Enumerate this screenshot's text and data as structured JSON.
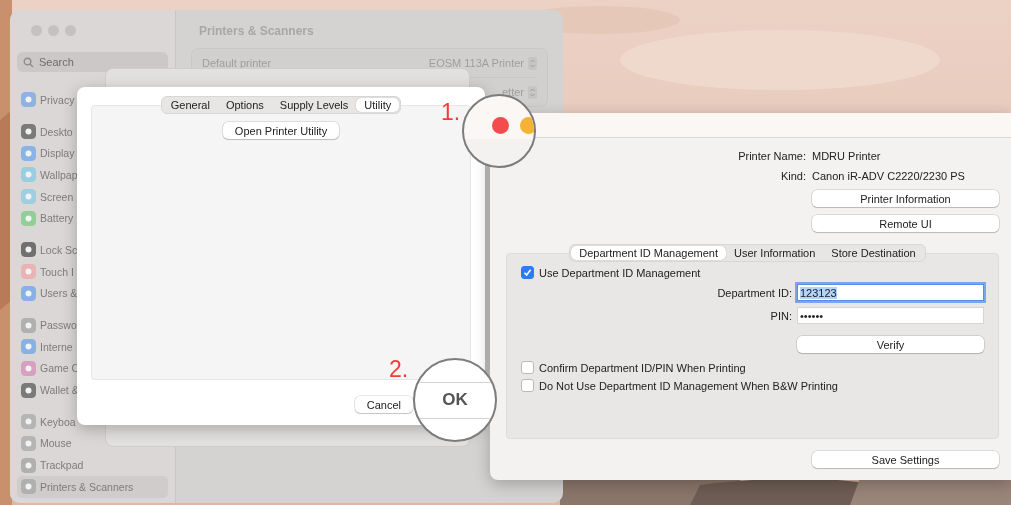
{
  "settings_window": {
    "title": "Printers & Scanners",
    "search": {
      "placeholder": "Search"
    },
    "sidebar": {
      "groups": [
        {
          "items": [
            {
              "label": "Privacy",
              "color": "#8fb2e0",
              "selected": false
            }
          ]
        },
        {
          "items": [
            {
              "label": "Deskto",
              "color": "#7a7a7a",
              "selected": false
            },
            {
              "label": "Display",
              "color": "#8ab4e6",
              "selected": false
            },
            {
              "label": "Wallpap",
              "color": "#98cde2",
              "selected": false
            },
            {
              "label": "Screen",
              "color": "#a0cde0",
              "selected": false
            },
            {
              "label": "Battery",
              "color": "#92cf98",
              "selected": false
            }
          ]
        },
        {
          "items": [
            {
              "label": "Lock Sc",
              "color": "#707070",
              "selected": false
            },
            {
              "label": "Touch I",
              "color": "#e8b4b4",
              "selected": false
            },
            {
              "label": "Users &",
              "color": "#88b0e6",
              "selected": false
            }
          ]
        },
        {
          "items": [
            {
              "label": "Passwo",
              "color": "#b0b0b0",
              "selected": false
            },
            {
              "label": "Interne",
              "color": "#88b0e6",
              "selected": false
            },
            {
              "label": "Game C",
              "color": "#d8a0c0",
              "selected": false
            },
            {
              "label": "Wallet &",
              "color": "#7a7a7a",
              "selected": false
            }
          ]
        },
        {
          "items": [
            {
              "label": "Keyboa",
              "color": "#b5b5b5",
              "selected": false
            },
            {
              "label": "Mouse",
              "color": "#b5b5b5",
              "selected": false
            },
            {
              "label": "Trackpad",
              "color": "#b0b0b0",
              "selected": false
            },
            {
              "label": "Printers & Scanners",
              "color": "#b0b0b0",
              "selected": true
            }
          ]
        }
      ]
    },
    "rows": [
      {
        "label": "Default printer",
        "value": "EOSM 113A Printer"
      },
      {
        "value": "etter"
      }
    ]
  },
  "dialog": {
    "tabs": [
      {
        "label": "General",
        "selected": false
      },
      {
        "label": "Options",
        "selected": false
      },
      {
        "label": "Supply Levels",
        "selected": false
      },
      {
        "label": "Utility",
        "selected": true
      }
    ],
    "open_utility_button": "Open Printer Utility",
    "cancel_button": "Cancel"
  },
  "annotations": [
    {
      "label": "1."
    },
    {
      "label": "2."
    }
  ],
  "ok_magnifier": {
    "text": "OK"
  },
  "printer_window": {
    "printer_name_label": "Printer Name:",
    "printer_name": "MDRU Printer",
    "kind_label": "Kind:",
    "kind": "Canon iR-ADV C2220/2230 PS",
    "buttons": [
      "Printer Information",
      "Remote UI"
    ],
    "tabs": [
      {
        "label": "Department ID Management",
        "selected": true
      },
      {
        "label": "User Information",
        "selected": false
      },
      {
        "label": "Store Destination",
        "selected": false
      }
    ],
    "use_department": {
      "label": "Use Department ID Management",
      "checked": true
    },
    "department_id": {
      "label": "Department ID:",
      "value": "123123",
      "focused": true
    },
    "pin": {
      "label": "PIN:",
      "value": "••••••"
    },
    "verify_button": "Verify",
    "options": [
      {
        "label": "Confirm Department ID/PIN When Printing",
        "checked": false
      },
      {
        "label": "Do Not Use Department ID Management When B&W Printing",
        "checked": false
      }
    ],
    "save_button": "Save Settings"
  }
}
